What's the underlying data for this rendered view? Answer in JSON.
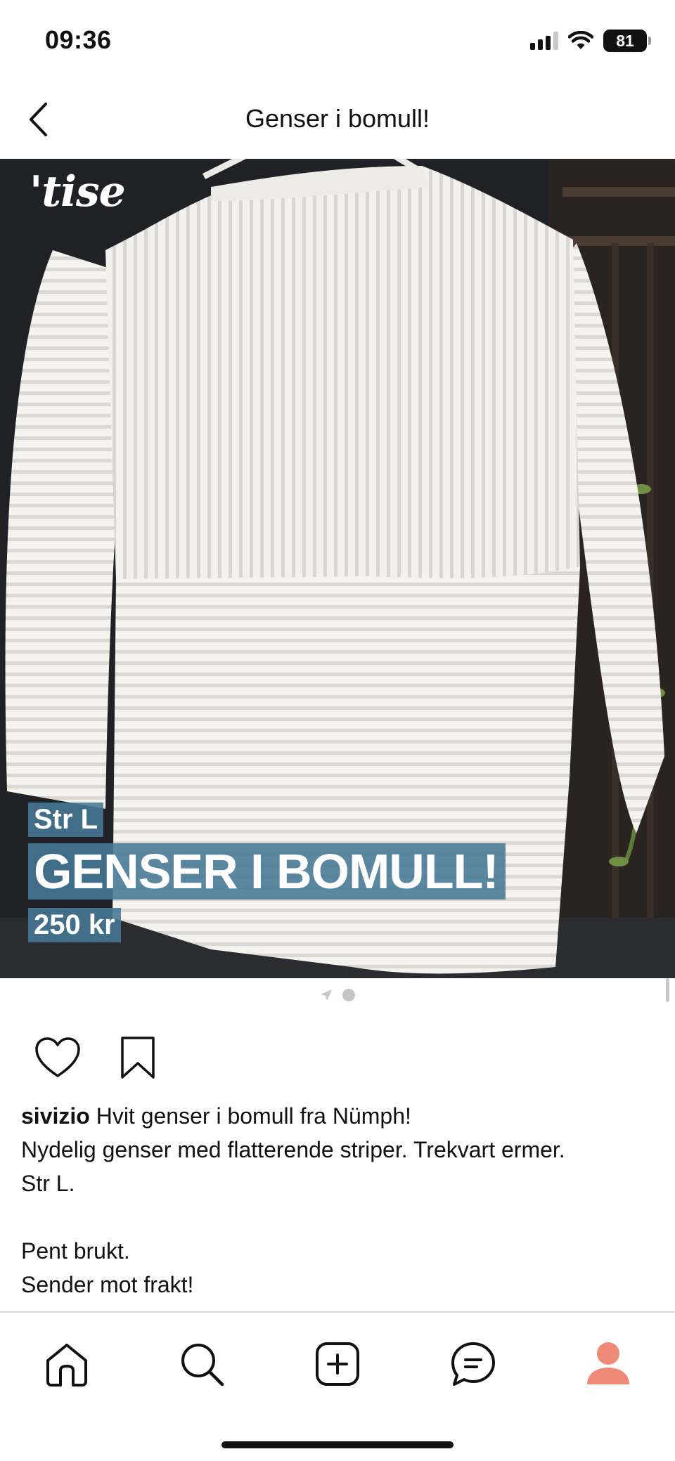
{
  "status_bar": {
    "time": "09:36",
    "battery": "81"
  },
  "header": {
    "title": "Genser i bomull!"
  },
  "photo": {
    "logo": "'tise",
    "overlay": {
      "size": "Str L",
      "title": "GENSER I BOMULL!",
      "price": "250 kr"
    }
  },
  "actions": {
    "like_icon": "heart-icon",
    "save_icon": "bookmark-icon"
  },
  "description": {
    "username": "sivizio",
    "first_line": " Hvit genser i bomull fra Nümph!",
    "lines": [
      "Nydelig genser med flatterende striper. Trekvart ermer.",
      "Str L.",
      "",
      "Pent brukt.",
      "Sender mot frakt!"
    ]
  },
  "tab_bar": {
    "items": [
      "home-icon",
      "search-icon",
      "add-icon",
      "chat-icon",
      "profile-icon"
    ],
    "active_color": "#f08a78"
  }
}
